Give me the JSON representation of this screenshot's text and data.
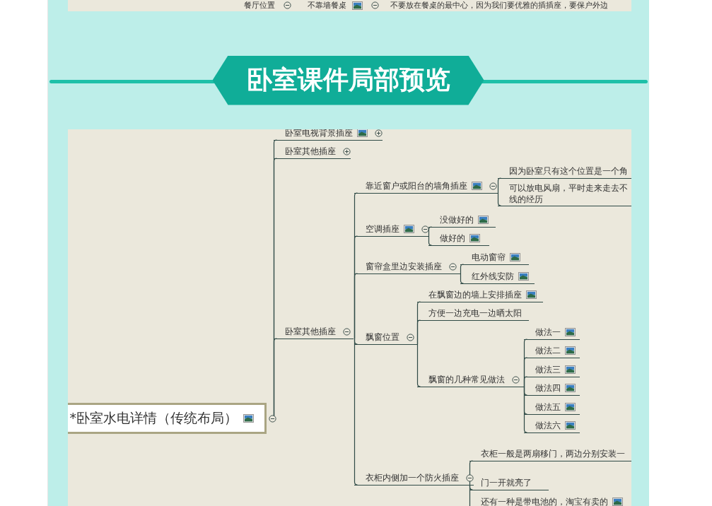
{
  "top_strip": {
    "nodes": [
      {
        "text": "餐厅位置",
        "expanded": true
      },
      {
        "text": "不靠墙餐桌",
        "image": true,
        "expanded": true
      },
      {
        "text": "不要放在餐桌的最中心，因为我们要优雅的插插座，要保户外边"
      }
    ]
  },
  "banner": {
    "title": "卧室课件局部预览"
  },
  "mind_map": {
    "root": {
      "text": "*卧室水电详情（传统布局）",
      "image": true,
      "expanded": true,
      "children": [
        {
          "text": "卧室电视背景插座",
          "image": true,
          "expanded": false
        },
        {
          "text": "卧室其他插座",
          "expanded": false
        },
        {
          "text": "卧室其他插座",
          "expanded": true,
          "children": [
            {
              "text": "靠近窗户或阳台的墙角插座",
              "image": true,
              "expanded": true,
              "children": [
                {
                  "text": "因为卧室只有这个位置是一个角"
                },
                {
                  "lines": [
                    "可以放电风扇，平时走来走去不",
                    "线的经历"
                  ]
                }
              ]
            },
            {
              "text": "空调插座",
              "image": true,
              "expanded": true,
              "children": [
                {
                  "text": "没做好的",
                  "image": true
                },
                {
                  "text": "做好的",
                  "image": true
                }
              ]
            },
            {
              "text": "窗帘盒里边安装插座",
              "expanded": true,
              "children": [
                {
                  "text": "电动窗帘",
                  "image": true
                },
                {
                  "text": "红外线安防",
                  "image": true
                }
              ]
            },
            {
              "text": "飘窗位置",
              "expanded": true,
              "children": [
                {
                  "text": "在飘窗边的墙上安排插座",
                  "image": true
                },
                {
                  "text": "方便一边充电一边晒太阳"
                },
                {
                  "text": "飘窗的几种常见做法",
                  "expanded": true,
                  "children": [
                    {
                      "text": "做法一",
                      "image": true
                    },
                    {
                      "text": "做法二",
                      "image": true
                    },
                    {
                      "text": "做法三",
                      "image": true
                    },
                    {
                      "text": "做法四",
                      "image": true
                    },
                    {
                      "text": "做法五",
                      "image": true
                    },
                    {
                      "text": "做法六",
                      "image": true
                    }
                  ]
                }
              ]
            },
            {
              "text": "衣柜内侧加一个防火插座",
              "expanded": true,
              "children": [
                {
                  "text": "衣柜一般是两扇移门，两边分别安装一"
                },
                {
                  "text": "门一开就亮了"
                },
                {
                  "text": "还有一种是带电池的，淘宝有卖的",
                  "image": true
                }
              ]
            }
          ]
        }
      ]
    }
  }
}
